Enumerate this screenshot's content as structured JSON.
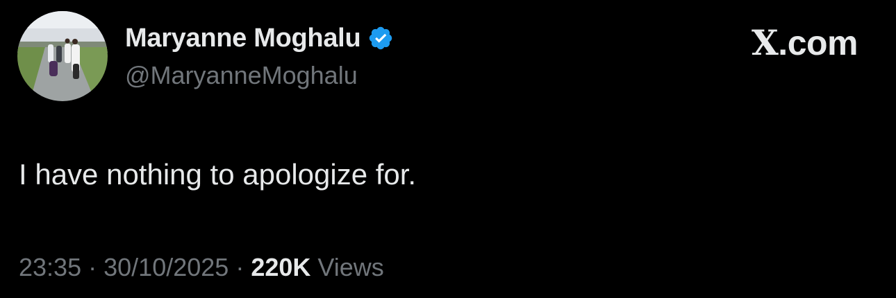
{
  "author": {
    "display_name": "Maryanne Moghalu",
    "handle": "@MaryanneMoghalu",
    "verified": true,
    "verified_icon": "verified-badge-icon"
  },
  "brand": {
    "x_letter": "X",
    "suffix": ".com"
  },
  "tweet": {
    "text": "I have nothing to apologize for."
  },
  "meta": {
    "time": "23:35",
    "separator": "·",
    "date": "30/10/2025",
    "views_count": "220K",
    "views_label": "Views"
  },
  "colors": {
    "background": "#000000",
    "primary_text": "#e7e9ea",
    "secondary_text": "#71767b",
    "verified_blue": "#1d9bf0"
  }
}
